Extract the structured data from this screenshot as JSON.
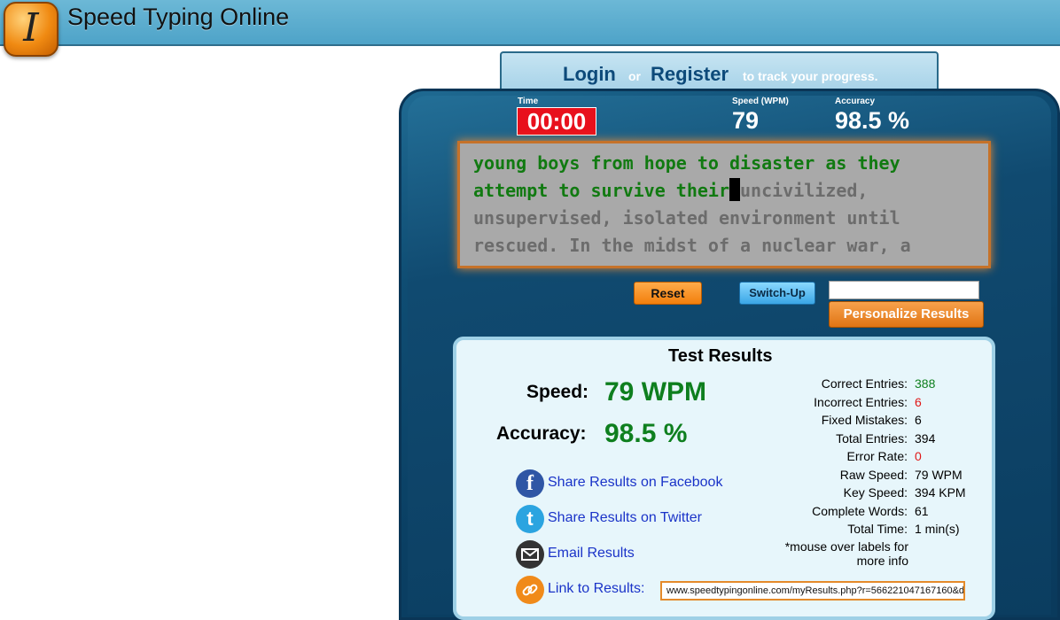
{
  "header": {
    "title": "Speed Typing Online",
    "logo_glyph": "I"
  },
  "login": {
    "login": "Login",
    "or": "or",
    "register": "Register",
    "track": "to track your progress."
  },
  "stats": {
    "time_label": "Time",
    "time_value": "00:00",
    "speed_label": "Speed (WPM)",
    "speed_value": "79",
    "accuracy_label": "Accuracy",
    "accuracy_value": "98.5 %"
  },
  "typing": {
    "typed": "young boys from hope to disaster as they attempt to survive their",
    "untyped": "uncivilized, unsupervised, isolated environment until rescued. In the midst of a nuclear war, a"
  },
  "buttons": {
    "reset": "Reset",
    "switch_up": "Switch-Up",
    "personalize": "Personalize Results",
    "name_input_value": ""
  },
  "results": {
    "title": "Test Results",
    "speed_label": "Speed:",
    "speed_value": "79 WPM",
    "accuracy_label": "Accuracy:",
    "accuracy_value": "98.5 %",
    "share": {
      "facebook": "Share Results on Facebook",
      "twitter": "Share Results on Twitter",
      "email": "Email Results",
      "link": "Link to Results:",
      "link_url": "www.speedtypingonline.com/myResults.php?r=566221047167160&d"
    },
    "details": [
      {
        "k": "Correct Entries:",
        "v": "388"
      },
      {
        "k": "Incorrect Entries:",
        "v": "6"
      },
      {
        "k": "Fixed Mistakes:",
        "v": "6"
      },
      {
        "k": "Total Entries:",
        "v": "394"
      },
      {
        "k": "Error Rate:",
        "v": "0"
      },
      {
        "k": "Raw Speed:",
        "v": "79 WPM"
      },
      {
        "k": "Key Speed:",
        "v": "394 KPM"
      },
      {
        "k": "Complete Words:",
        "v": "61"
      },
      {
        "k": "Total Time:",
        "v": "1 min(s)"
      }
    ],
    "note": "*mouse over labels for more info"
  },
  "colors": {
    "header": "#5aafd0",
    "panel": "#0f4d73",
    "typed_text": "#117a11",
    "value_green": "#0e7f1e",
    "value_red": "#e01818",
    "link_blue": "#1a33c8"
  },
  "icons": {
    "facebook": "facebook-icon",
    "twitter": "twitter-icon",
    "email": "email-icon",
    "link": "link-icon"
  }
}
